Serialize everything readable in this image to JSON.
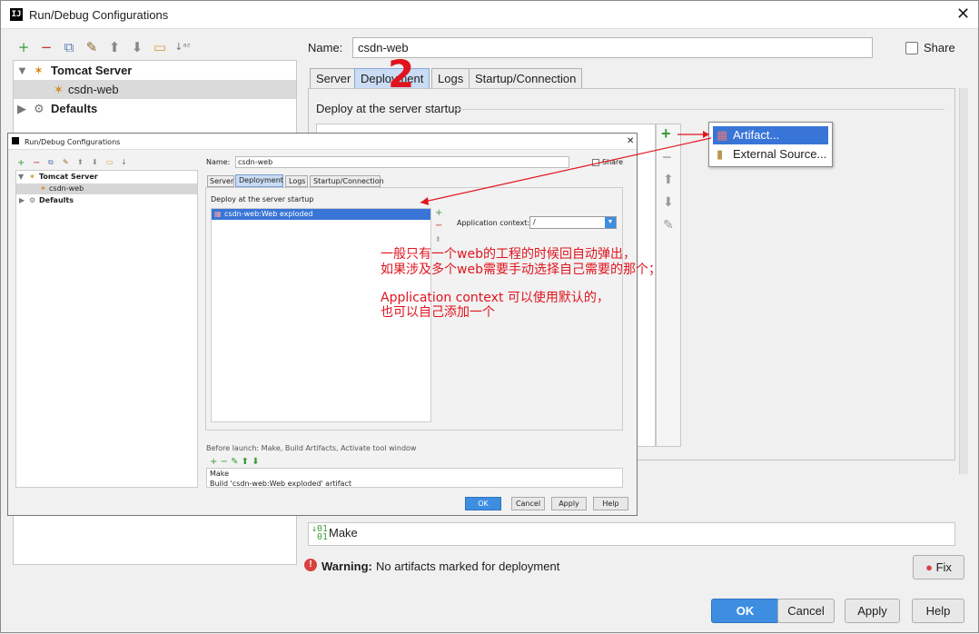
{
  "window": {
    "title": "Run/Debug Configurations",
    "icon_text": "IJ"
  },
  "toolbar": {
    "icons": [
      "add-icon",
      "remove-icon",
      "copy-icon",
      "wrench-icon",
      "arrow-up-icon",
      "arrow-down-icon",
      "folder-icon",
      "sort-icon"
    ]
  },
  "tree": {
    "tomcat": "Tomcat Server",
    "csdn": "csdn-web",
    "defaults": "Defaults"
  },
  "name_label": "Name:",
  "name_value": "csdn-web",
  "share_label": "Share",
  "tabs": [
    "Server",
    "Deployment",
    "Logs",
    "Startup/Connection"
  ],
  "deploy_label": "Deploy at the server startup",
  "popup": {
    "artifact": "Artifact...",
    "external": "External Source..."
  },
  "before_launch": {
    "make": "Make"
  },
  "warning": {
    "bold": "Warning:",
    "text": "No artifacts marked for deployment"
  },
  "buttons": {
    "fix": "Fix",
    "ok": "OK",
    "cancel": "Cancel",
    "apply": "Apply",
    "help": "Help"
  },
  "inner": {
    "title": "Run/Debug Configurations",
    "name_label": "Name:",
    "name_value": "csdn-web",
    "share": "Share",
    "tree_tomcat": "Tomcat Server",
    "tree_csdn": "csdn-web",
    "tree_defaults": "Defaults",
    "tabs": [
      "Server",
      "Deployment",
      "Logs",
      "Startup/Connection"
    ],
    "deploy_label": "Deploy at the server startup",
    "artifact_item": "csdn-web:Web exploded",
    "app_context_label": "Application context:",
    "app_context_value": "/",
    "before_launch": "Before launch: Make, Build Artifacts, Activate tool window",
    "bl_make": "Make",
    "bl_build": "Build 'csdn-web:Web exploded' artifact",
    "buttons": {
      "ok": "OK",
      "cancel": "Cancel",
      "apply": "Apply",
      "help": "Help"
    }
  },
  "annotation": {
    "line1": "一般只有一个web的工程的时候回自动弹出，",
    "line2": "如果涉及多个web需要手动选择自己需要的那个；",
    "line3": "Application context 可以使用默认的，",
    "line4": "也可以自己添加一个",
    "step_mark": "2"
  },
  "colors": {
    "accent": "#3d8ee0",
    "annotation": "#e0141e",
    "selection": "#3875d7"
  }
}
